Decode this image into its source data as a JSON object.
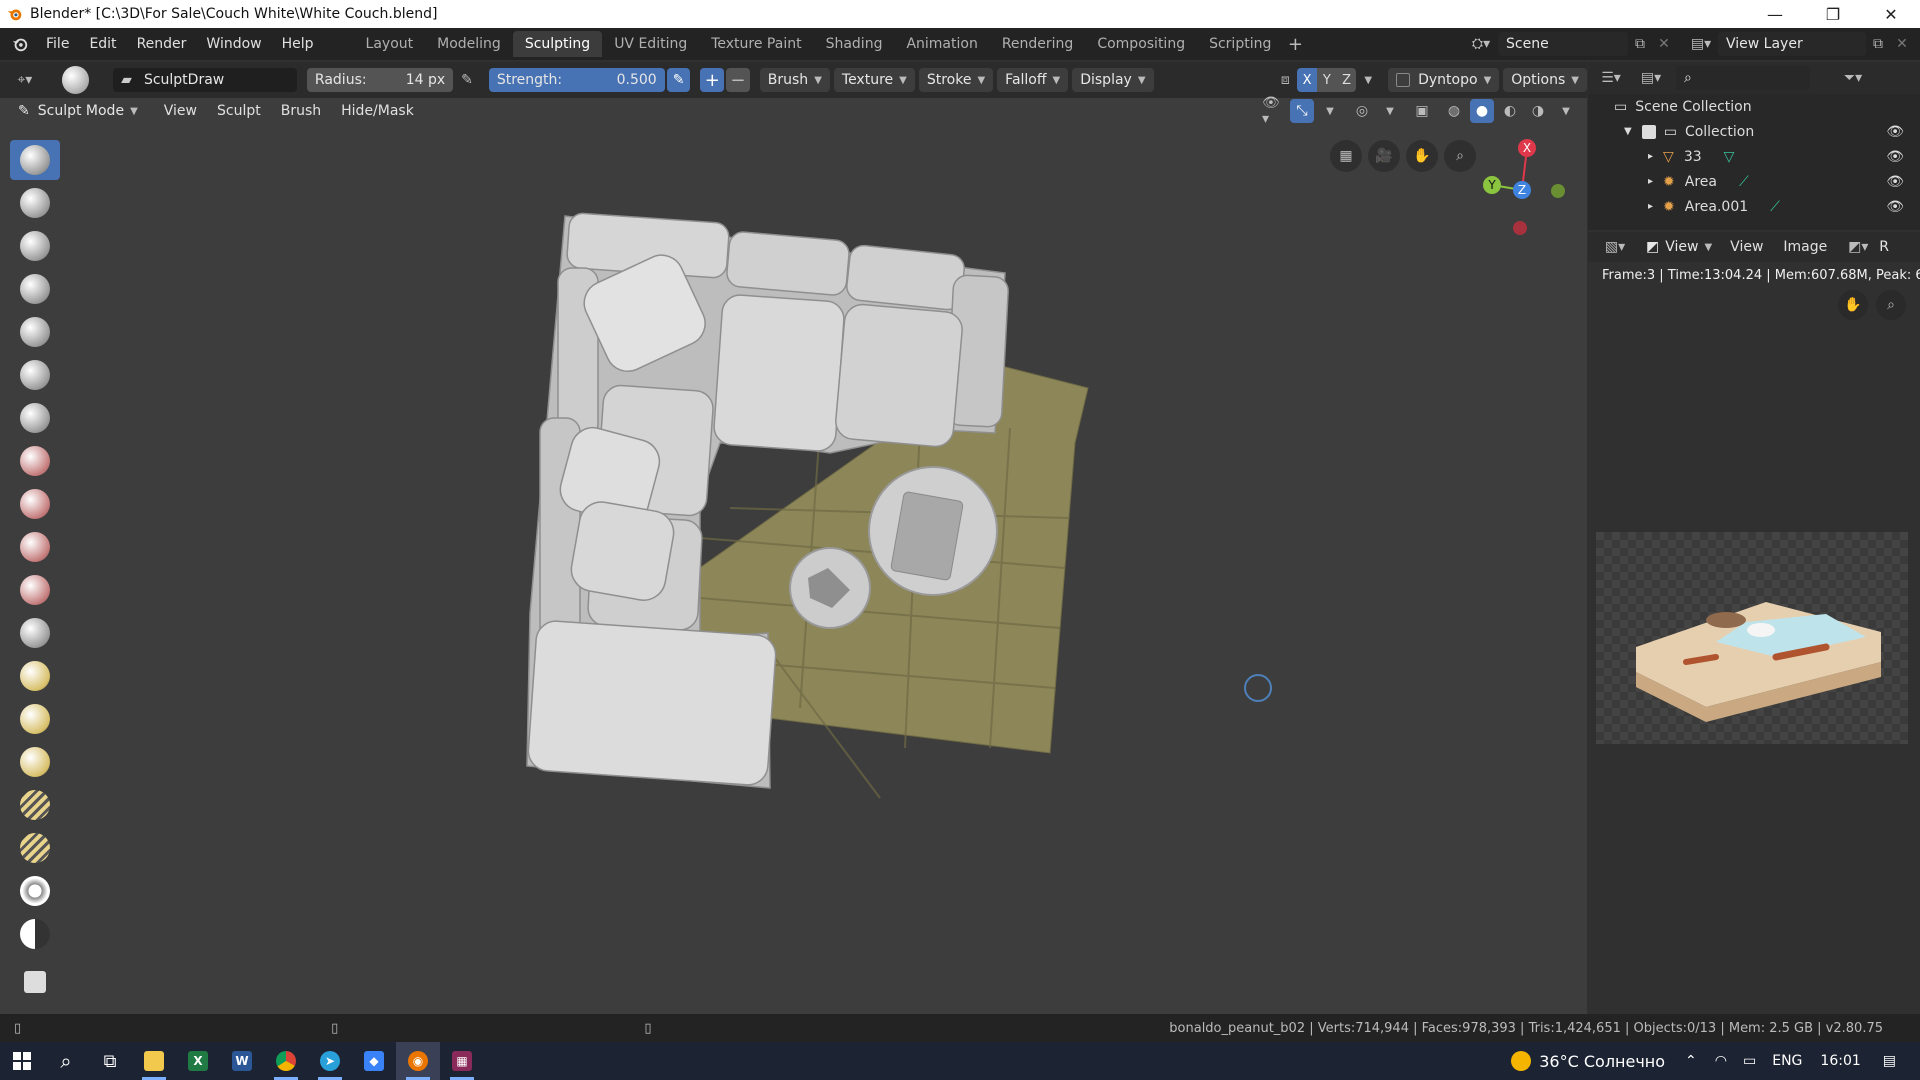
{
  "window": {
    "title": "Blender* [C:\\3D\\For Sale\\Couch White\\White Couch.blend]",
    "controls": [
      "—",
      "❐",
      "✕"
    ]
  },
  "menus": [
    "File",
    "Edit",
    "Render",
    "Window",
    "Help"
  ],
  "workspaces": [
    "Layout",
    "Modeling",
    "Sculpting",
    "UV Editing",
    "Texture Paint",
    "Shading",
    "Animation",
    "Rendering",
    "Compositing",
    "Scripting"
  ],
  "active_workspace": "Sculpting",
  "scene": {
    "name": "Scene",
    "view_layer": "View Layer"
  },
  "tool_header": {
    "brush_name": "SculptDraw",
    "radius_label": "Radius:",
    "radius_value": "14 px",
    "strength_label": "Strength:",
    "strength_value": "0.500",
    "plus": "+",
    "minus": "−",
    "dropdowns": [
      "Brush",
      "Texture",
      "Stroke",
      "Falloff",
      "Display"
    ],
    "axes": [
      "X",
      "Y",
      "Z"
    ],
    "dyntopo": "Dyntopo",
    "options": "Options"
  },
  "mode_header": {
    "mode": "Sculpt Mode",
    "menus": [
      "View",
      "Sculpt",
      "Brush",
      "Hide/Mask"
    ]
  },
  "gizmo": {
    "x": "X",
    "y": "Y",
    "z": "Z"
  },
  "outliner": {
    "root": "Scene Collection",
    "collection": "Collection",
    "items": [
      "33",
      "Area",
      "Area.001"
    ]
  },
  "image_editor": {
    "view_menu": "View",
    "menus": [
      "View",
      "Image"
    ],
    "cut_label": "R",
    "render_info": "Frame:3 | Time:13:04.24 | Mem:607.68M, Peak: 6"
  },
  "status_bar": {
    "text": "bonaldo_peanut_b02 | Verts:714,944 | Faces:978,393 | Tris:1,424,651 | Objects:0/13 | Mem: 2.5 GB | v2.80.75"
  },
  "taskbar": {
    "weather": "36°C Солнечно",
    "language": "ENG",
    "time": "16:01"
  },
  "colors": {
    "accent": "#4772b3",
    "viewport_bg": "#3d3d3d",
    "rug": "#8c8658",
    "axis_x": "#e0384b",
    "axis_y": "#8bc43f",
    "axis_z": "#3f83e0"
  }
}
